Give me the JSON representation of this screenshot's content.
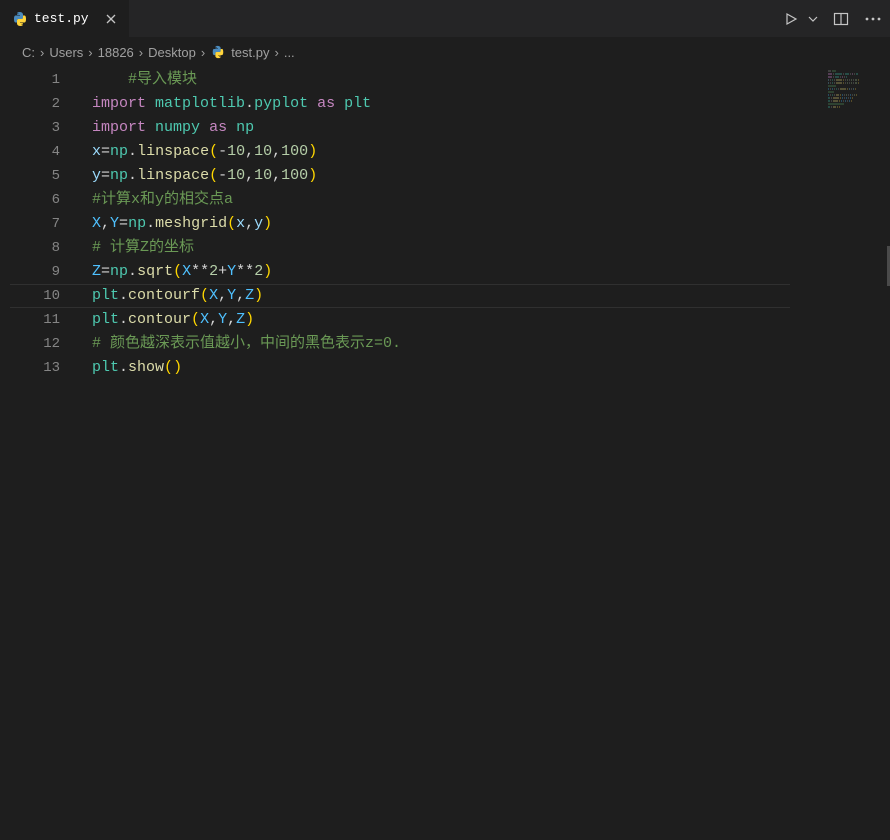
{
  "tab": {
    "filename": "test.py",
    "icon": "python-icon"
  },
  "toolbar": {
    "run": "run-icon",
    "split": "split-icon",
    "more": "more-icon"
  },
  "breadcrumbs": {
    "items": [
      "C:",
      "Users",
      "18826",
      "Desktop"
    ],
    "file_icon": "python-icon",
    "file": "test.py",
    "symbol": "..."
  },
  "code": {
    "lines": [
      {
        "n": "1",
        "tokens": [
          {
            "t": "    ",
            "c": "c-plain"
          },
          {
            "t": "#导入模块",
            "c": "c-comment"
          }
        ]
      },
      {
        "n": "2",
        "tokens": [
          {
            "t": "import",
            "c": "c-keyword"
          },
          {
            "t": " ",
            "c": "c-plain"
          },
          {
            "t": "matplotlib",
            "c": "c-module"
          },
          {
            "t": ".",
            "c": "c-punc"
          },
          {
            "t": "pyplot",
            "c": "c-module"
          },
          {
            "t": " ",
            "c": "c-plain"
          },
          {
            "t": "as",
            "c": "c-keyword"
          },
          {
            "t": " ",
            "c": "c-plain"
          },
          {
            "t": "plt",
            "c": "c-module"
          }
        ]
      },
      {
        "n": "3",
        "tokens": [
          {
            "t": "import",
            "c": "c-keyword"
          },
          {
            "t": " ",
            "c": "c-plain"
          },
          {
            "t": "numpy",
            "c": "c-module"
          },
          {
            "t": " ",
            "c": "c-plain"
          },
          {
            "t": "as",
            "c": "c-keyword"
          },
          {
            "t": " ",
            "c": "c-plain"
          },
          {
            "t": "np",
            "c": "c-module"
          }
        ]
      },
      {
        "n": "4",
        "tokens": [
          {
            "t": "x",
            "c": "c-var"
          },
          {
            "t": "=",
            "c": "c-op"
          },
          {
            "t": "np",
            "c": "c-module"
          },
          {
            "t": ".",
            "c": "c-punc"
          },
          {
            "t": "linspace",
            "c": "c-func"
          },
          {
            "t": "(",
            "c": "c-paren"
          },
          {
            "t": "-",
            "c": "c-op"
          },
          {
            "t": "10",
            "c": "c-num"
          },
          {
            "t": ",",
            "c": "c-punc"
          },
          {
            "t": "10",
            "c": "c-num"
          },
          {
            "t": ",",
            "c": "c-punc"
          },
          {
            "t": "100",
            "c": "c-num"
          },
          {
            "t": ")",
            "c": "c-paren"
          }
        ]
      },
      {
        "n": "5",
        "tokens": [
          {
            "t": "y",
            "c": "c-var"
          },
          {
            "t": "=",
            "c": "c-op"
          },
          {
            "t": "np",
            "c": "c-module"
          },
          {
            "t": ".",
            "c": "c-punc"
          },
          {
            "t": "linspace",
            "c": "c-func"
          },
          {
            "t": "(",
            "c": "c-paren"
          },
          {
            "t": "-",
            "c": "c-op"
          },
          {
            "t": "10",
            "c": "c-num"
          },
          {
            "t": ",",
            "c": "c-punc"
          },
          {
            "t": "10",
            "c": "c-num"
          },
          {
            "t": ",",
            "c": "c-punc"
          },
          {
            "t": "100",
            "c": "c-num"
          },
          {
            "t": ")",
            "c": "c-paren"
          }
        ]
      },
      {
        "n": "6",
        "tokens": [
          {
            "t": "#计算x和y的相交点a",
            "c": "c-comment"
          }
        ]
      },
      {
        "n": "7",
        "tokens": [
          {
            "t": "X",
            "c": "c-const"
          },
          {
            "t": ",",
            "c": "c-punc"
          },
          {
            "t": "Y",
            "c": "c-const"
          },
          {
            "t": "=",
            "c": "c-op"
          },
          {
            "t": "np",
            "c": "c-module"
          },
          {
            "t": ".",
            "c": "c-punc"
          },
          {
            "t": "meshgrid",
            "c": "c-func"
          },
          {
            "t": "(",
            "c": "c-paren"
          },
          {
            "t": "x",
            "c": "c-var"
          },
          {
            "t": ",",
            "c": "c-punc"
          },
          {
            "t": "y",
            "c": "c-var"
          },
          {
            "t": ")",
            "c": "c-paren"
          }
        ]
      },
      {
        "n": "8",
        "tokens": [
          {
            "t": "# 计算Z的坐标",
            "c": "c-comment"
          }
        ]
      },
      {
        "n": "9",
        "tokens": [
          {
            "t": "Z",
            "c": "c-const"
          },
          {
            "t": "=",
            "c": "c-op"
          },
          {
            "t": "np",
            "c": "c-module"
          },
          {
            "t": ".",
            "c": "c-punc"
          },
          {
            "t": "sqrt",
            "c": "c-func"
          },
          {
            "t": "(",
            "c": "c-paren"
          },
          {
            "t": "X",
            "c": "c-const"
          },
          {
            "t": "**",
            "c": "c-op"
          },
          {
            "t": "2",
            "c": "c-num"
          },
          {
            "t": "+",
            "c": "c-op"
          },
          {
            "t": "Y",
            "c": "c-const"
          },
          {
            "t": "**",
            "c": "c-op"
          },
          {
            "t": "2",
            "c": "c-num"
          },
          {
            "t": ")",
            "c": "c-paren"
          }
        ]
      },
      {
        "n": "10",
        "tokens": [
          {
            "t": "plt",
            "c": "c-module"
          },
          {
            "t": ".",
            "c": "c-punc"
          },
          {
            "t": "contourf",
            "c": "c-func"
          },
          {
            "t": "(",
            "c": "c-paren"
          },
          {
            "t": "X",
            "c": "c-const"
          },
          {
            "t": ",",
            "c": "c-punc"
          },
          {
            "t": "Y",
            "c": "c-const"
          },
          {
            "t": ",",
            "c": "c-punc"
          },
          {
            "t": "Z",
            "c": "c-const"
          },
          {
            "t": ")",
            "c": "c-paren"
          }
        ]
      },
      {
        "n": "11",
        "tokens": [
          {
            "t": "plt",
            "c": "c-module"
          },
          {
            "t": ".",
            "c": "c-punc"
          },
          {
            "t": "contour",
            "c": "c-func"
          },
          {
            "t": "(",
            "c": "c-paren"
          },
          {
            "t": "X",
            "c": "c-const"
          },
          {
            "t": ",",
            "c": "c-punc"
          },
          {
            "t": "Y",
            "c": "c-const"
          },
          {
            "t": ",",
            "c": "c-punc"
          },
          {
            "t": "Z",
            "c": "c-const"
          },
          {
            "t": ")",
            "c": "c-paren"
          }
        ]
      },
      {
        "n": "12",
        "tokens": [
          {
            "t": "# 颜色越深表示值越小，中间的黑色表示z=0.",
            "c": "c-comment"
          }
        ]
      },
      {
        "n": "13",
        "tokens": [
          {
            "t": "plt",
            "c": "c-module"
          },
          {
            "t": ".",
            "c": "c-punc"
          },
          {
            "t": "show",
            "c": "c-func"
          },
          {
            "t": "(",
            "c": "c-paren"
          },
          {
            "t": ")",
            "c": "c-paren"
          }
        ]
      }
    ]
  }
}
